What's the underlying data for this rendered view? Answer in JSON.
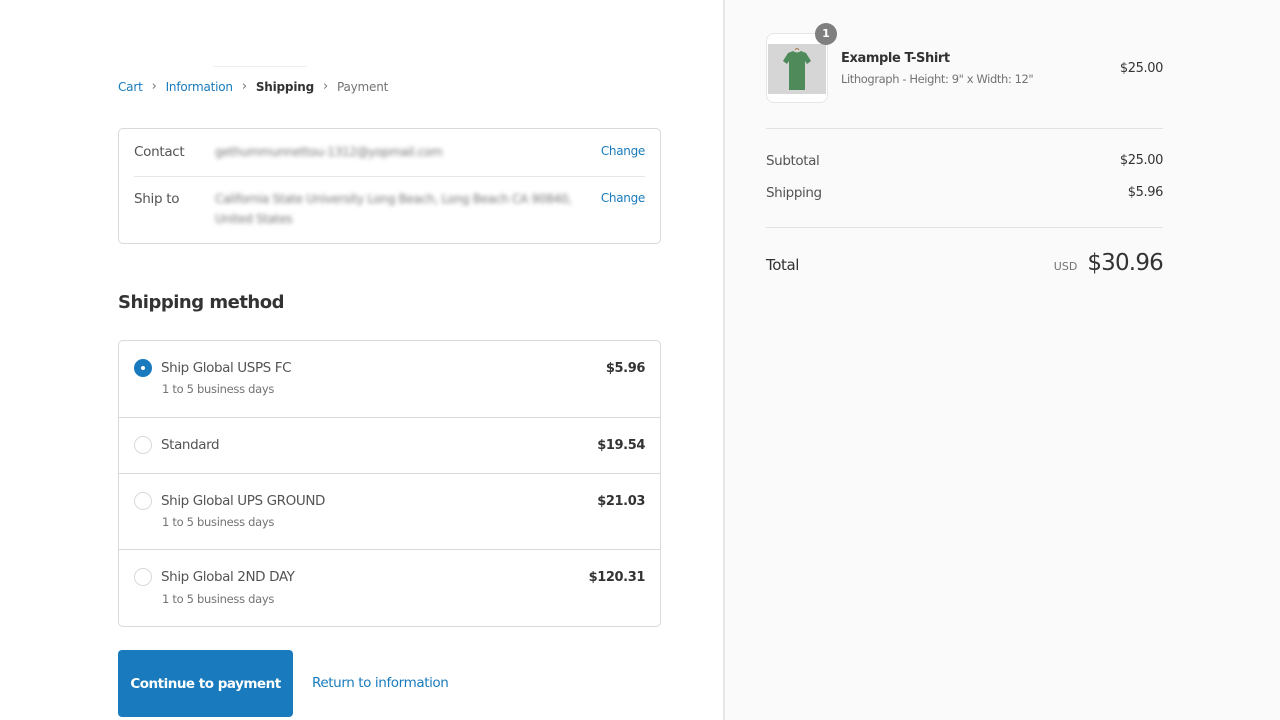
{
  "breadcrumb": [
    {
      "label": "Cart",
      "state": "link"
    },
    {
      "label": "Information",
      "state": "link"
    },
    {
      "label": "Shipping",
      "state": "current"
    },
    {
      "label": "Payment",
      "state": "future"
    }
  ],
  "breadcrumb_separator": "›",
  "review": {
    "contact": {
      "label": "Contact",
      "value": "gethummunnettou-1312@yopmail.com",
      "action": "Change"
    },
    "ship_to": {
      "label": "Ship to",
      "value": "California State University Long Beach, Long Beach CA 90840, United States",
      "action": "Change"
    }
  },
  "shipping_method": {
    "title": "Shipping method",
    "options": [
      {
        "name": "Ship Global USPS FC",
        "subtitle": "1 to 5 business days",
        "price": "$5.96",
        "selected": true
      },
      {
        "name": "Standard",
        "subtitle": "",
        "price": "$19.54",
        "selected": false
      },
      {
        "name": "Ship Global UPS GROUND",
        "subtitle": "1 to 5 business days",
        "price": "$21.03",
        "selected": false
      },
      {
        "name": "Ship Global 2ND DAY",
        "subtitle": "1 to 5 business days",
        "price": "$120.31",
        "selected": false
      }
    ]
  },
  "actions": {
    "continue_label": "Continue to payment",
    "return_label": "Return to information"
  },
  "order_summary": {
    "product": {
      "quantity": "1",
      "name": "Example T-Shirt",
      "variant": "Lithograph - Height: 9\" x Width: 12\"",
      "price": "$25.00",
      "image": "green-tshirt-image"
    },
    "subtotal_label": "Subtotal",
    "subtotal_value": "$25.00",
    "shipping_label": "Shipping",
    "shipping_value": "$5.96",
    "total_label": "Total",
    "currency": "USD",
    "total_value": "$30.96"
  },
  "colors": {
    "accent": "#197bbd",
    "sidebar_bg": "#fafafa",
    "badge": "#7f7f7f"
  }
}
